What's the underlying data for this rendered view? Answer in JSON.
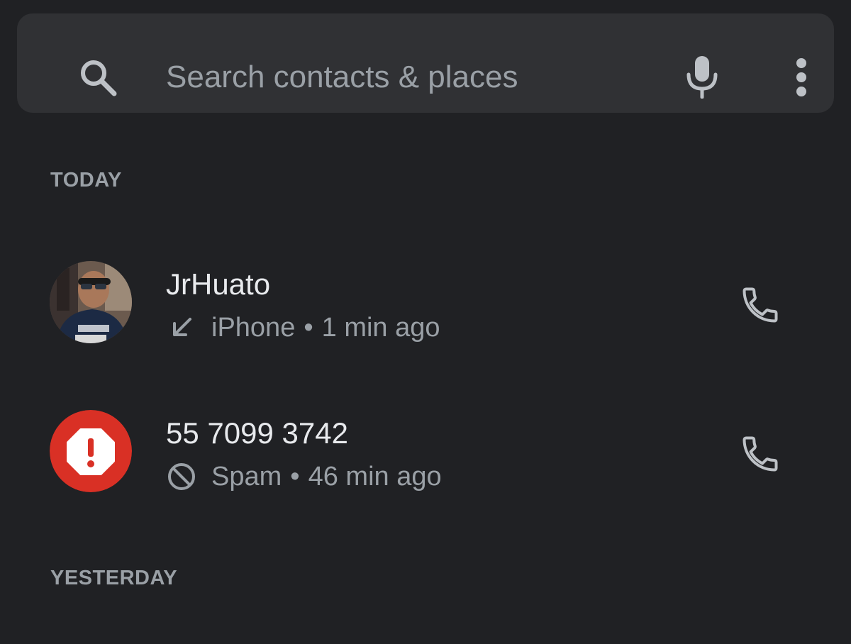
{
  "search": {
    "placeholder": "Search contacts & places",
    "search_icon": "search-icon",
    "mic_icon": "mic-icon",
    "more_icon": "more-vert-icon"
  },
  "sections": {
    "today": "TODAY",
    "yesterday": "YESTERDAY"
  },
  "calls": [
    {
      "name": "JrHuato",
      "type_icon": "incoming-call-arrow-icon",
      "detail": "iPhone",
      "separator": "•",
      "time": "1 min ago",
      "avatar": "contact-photo",
      "action_icon": "phone-icon"
    },
    {
      "name": "55 7099 3742",
      "type_icon": "blocked-icon",
      "detail": "Spam",
      "separator": "•",
      "time": "46 min ago",
      "avatar": "spam-warning-avatar",
      "action_icon": "phone-icon"
    }
  ],
  "colors": {
    "background": "#202124",
    "search_bar": "#303134",
    "primary_text": "#e8eaed",
    "secondary_text": "#9aa0a6",
    "spam_red": "#d93025"
  }
}
